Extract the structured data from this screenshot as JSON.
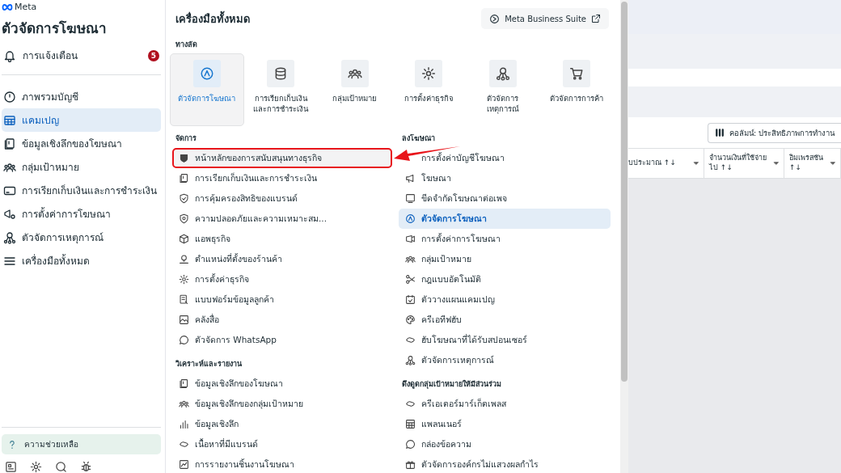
{
  "brand": "Meta",
  "sidebar": {
    "title": "ตัวจัดการโฆษณา",
    "notifications": {
      "label": "การแจ้งเตือน",
      "badge": "5"
    },
    "items": [
      {
        "label": "ภาพรวมบัญชี",
        "selected": false
      },
      {
        "label": "แคมเปญ",
        "selected": true
      },
      {
        "label": "ข้อมูลเชิงลึกของโฆษณา",
        "selected": false
      },
      {
        "label": "กลุ่มเป้าหมาย",
        "selected": false
      },
      {
        "label": "การเรียกเก็บเงินและการชำระเงิน",
        "selected": false
      },
      {
        "label": "การตั้งค่าการโฆษณา",
        "selected": false
      },
      {
        "label": "ตัวจัดการเหตุการณ์",
        "selected": false
      },
      {
        "label": "เครื่องมือทั้งหมด",
        "selected": false
      }
    ],
    "help": "ความช่วยเหลือ"
  },
  "panel": {
    "title": "เครื่องมือทั้งหมด",
    "suite_button": "Meta Business Suite",
    "shortcuts_heading": "ทางลัด",
    "shortcuts": [
      {
        "label": "ตัวจัดการโฆษณา",
        "selected": true
      },
      {
        "label": "การเรียกเก็บเงินและการชำระเงิน",
        "selected": false
      },
      {
        "label": "กลุ่มเป้าหมาย",
        "selected": false
      },
      {
        "label": "การตั้งค่าธุรกิจ",
        "selected": false
      },
      {
        "label": "ตัวจัดการเหตุการณ์",
        "selected": false
      },
      {
        "label": "ตัวจัดการการค้า",
        "selected": false
      }
    ],
    "columns": [
      [
        {
          "heading": "จัดการ",
          "items": [
            {
              "label": "หน้าหลักของการสนับสนุนทางธุรกิจ",
              "selected": false,
              "highlighted": true
            },
            {
              "label": "การเรียกเก็บเงินและการชำระเงิน",
              "selected": false,
              "highlighted": false
            },
            {
              "label": "การคุ้มครองสิทธิของแบรนด์",
              "selected": false,
              "highlighted": false
            },
            {
              "label": "ความปลอดภัยและความเหมาะสม...",
              "selected": false,
              "highlighted": false
            },
            {
              "label": "แอพธุรกิจ",
              "selected": false,
              "highlighted": false
            },
            {
              "label": "ตำแหน่งที่ตั้งของร้านค้า",
              "selected": false,
              "highlighted": false
            },
            {
              "label": "การตั้งค่าธุรกิจ",
              "selected": false,
              "highlighted": false
            },
            {
              "label": "แบบฟอร์มข้อมูลลูกค้า",
              "selected": false,
              "highlighted": false
            },
            {
              "label": "คลังสื่อ",
              "selected": false,
              "highlighted": false
            },
            {
              "label": "ตัวจัดการ WhatsApp",
              "selected": false,
              "highlighted": false
            }
          ]
        },
        {
          "heading": "วิเคราะห์และรายงาน",
          "items": [
            {
              "label": "ข้อมูลเชิงลึกของโฆษณา",
              "selected": false,
              "highlighted": false
            },
            {
              "label": "ข้อมูลเชิงลึกของกลุ่มเป้าหมาย",
              "selected": false,
              "highlighted": false
            },
            {
              "label": "ข้อมูลเชิงลึก",
              "selected": false,
              "highlighted": false
            },
            {
              "label": "เนื้อหาที่มีแบรนด์",
              "selected": false,
              "highlighted": false
            },
            {
              "label": "การรายงานชิ้นงานโฆษณา",
              "selected": false,
              "highlighted": false
            }
          ]
        }
      ],
      [
        {
          "heading": "ลงโฆษณา",
          "items": [
            {
              "label": "การตั้งค่าบัญชีโฆษณา",
              "selected": false,
              "highlighted": false
            },
            {
              "label": "โฆษณา",
              "selected": false,
              "highlighted": false
            },
            {
              "label": "ขีดจำกัดโฆษณาต่อเพจ",
              "selected": false,
              "highlighted": false
            },
            {
              "label": "ตัวจัดการโฆษณา",
              "selected": true,
              "highlighted": false
            },
            {
              "label": "การตั้งค่าการโฆษณา",
              "selected": false,
              "highlighted": false
            },
            {
              "label": "กลุ่มเป้าหมาย",
              "selected": false,
              "highlighted": false
            },
            {
              "label": "กฎแบบอัตโนมัติ",
              "selected": false,
              "highlighted": false
            },
            {
              "label": "ตัววางแผนแคมเปญ",
              "selected": false,
              "highlighted": false
            },
            {
              "label": "ครีเอทีฟฮับ",
              "selected": false,
              "highlighted": false
            },
            {
              "label": "ฮับโฆษณาที่ได้รับสปอนเซอร์",
              "selected": false,
              "highlighted": false
            },
            {
              "label": "ตัวจัดการเหตุการณ์",
              "selected": false,
              "highlighted": false
            }
          ]
        },
        {
          "heading": "ดึงดูดกลุ่มเป้าหมายให้มีส่วนร่วม",
          "items": [
            {
              "label": "ครีเอเตอร์มาร์เก็ตเพลส",
              "selected": false,
              "highlighted": false
            },
            {
              "label": "แพลนเนอร์",
              "selected": false,
              "highlighted": false
            },
            {
              "label": "กล่องข้อความ",
              "selected": false,
              "highlighted": false
            },
            {
              "label": "ตัวจัดการองค์กรไม่แสวงผลกำไร",
              "selected": false,
              "highlighted": false
            }
          ]
        }
      ]
    ]
  },
  "background": {
    "columns_button": "คอลัมน์: ประสิทธิภาพการทำงาน",
    "table_columns": [
      {
        "label": "บประมาณ ↑↓"
      },
      {
        "label": "จำนวนเงินที่ใช้จ่ายไป ↑↓"
      },
      {
        "label": "อิมเพรสชัน ↑↓"
      }
    ]
  }
}
